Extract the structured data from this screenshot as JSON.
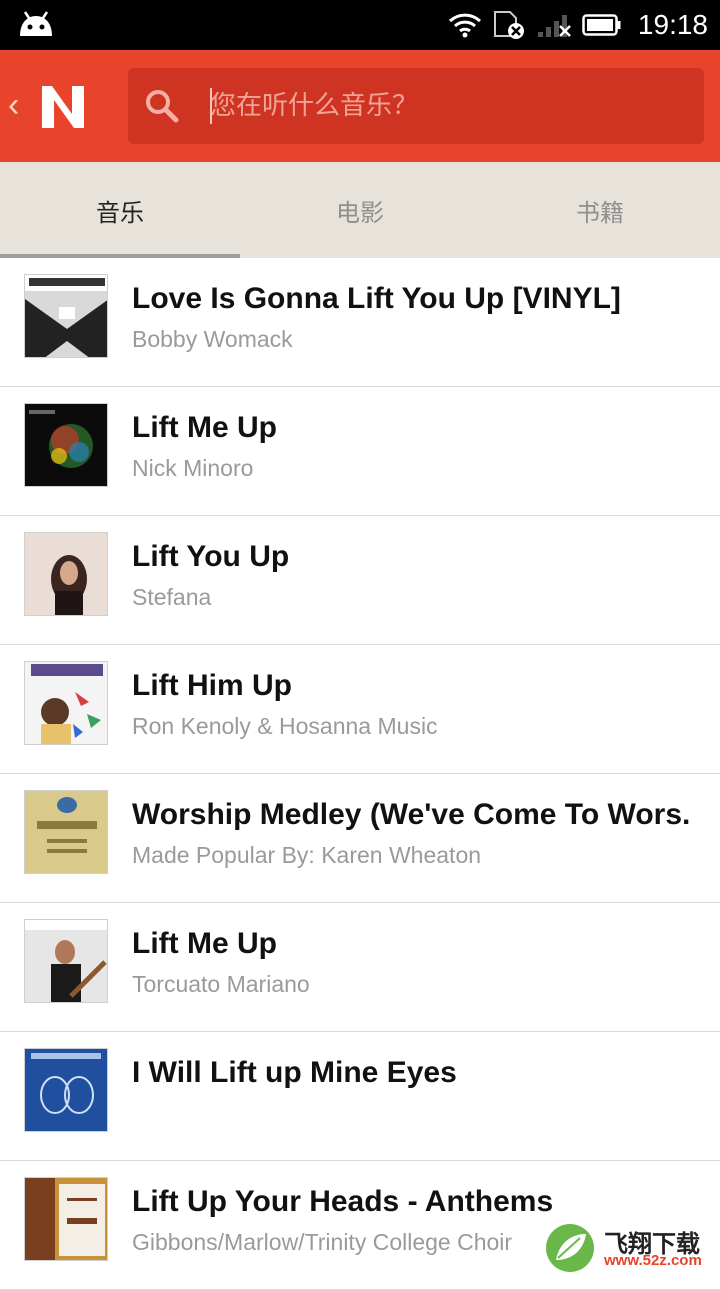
{
  "status_bar": {
    "time": "19:18",
    "icons": [
      "android-icon",
      "wifi-icon",
      "sim-off-icon",
      "signal-icon",
      "battery-icon"
    ]
  },
  "app_bar": {
    "back_glyph": "‹",
    "logo_letter": "N",
    "search_placeholder": "您在听什么音乐？"
  },
  "tabs": [
    {
      "label": "音乐",
      "active": true
    },
    {
      "label": "电影",
      "active": false
    },
    {
      "label": "书籍",
      "active": false
    }
  ],
  "results": [
    {
      "title": "Love Is Gonna Lift You Up [VINYL]",
      "artist": "Bobby Womack"
    },
    {
      "title": "Lift Me Up",
      "artist": "Nick Minoro"
    },
    {
      "title": "Lift You Up",
      "artist": "Stefana"
    },
    {
      "title": "Lift Him Up",
      "artist": "Ron Kenoly & Hosanna Music"
    },
    {
      "title": "Worship Medley (We've Come To Wors.",
      "artist": "Made Popular By: Karen Wheaton"
    },
    {
      "title": "Lift Me Up",
      "artist": "Torcuato Mariano"
    },
    {
      "title": "I Will Lift up Mine Eyes",
      "artist": ""
    },
    {
      "title": "Lift Up Your Heads - Anthems",
      "artist": "Gibbons/Marlow/Trinity College Choir"
    }
  ],
  "watermark": {
    "text": "飞翔下载",
    "url": "www.52z.com"
  },
  "colors": {
    "accent": "#e8432b",
    "search_bg": "#cf3422",
    "tabs_bg": "#e8e3da"
  }
}
